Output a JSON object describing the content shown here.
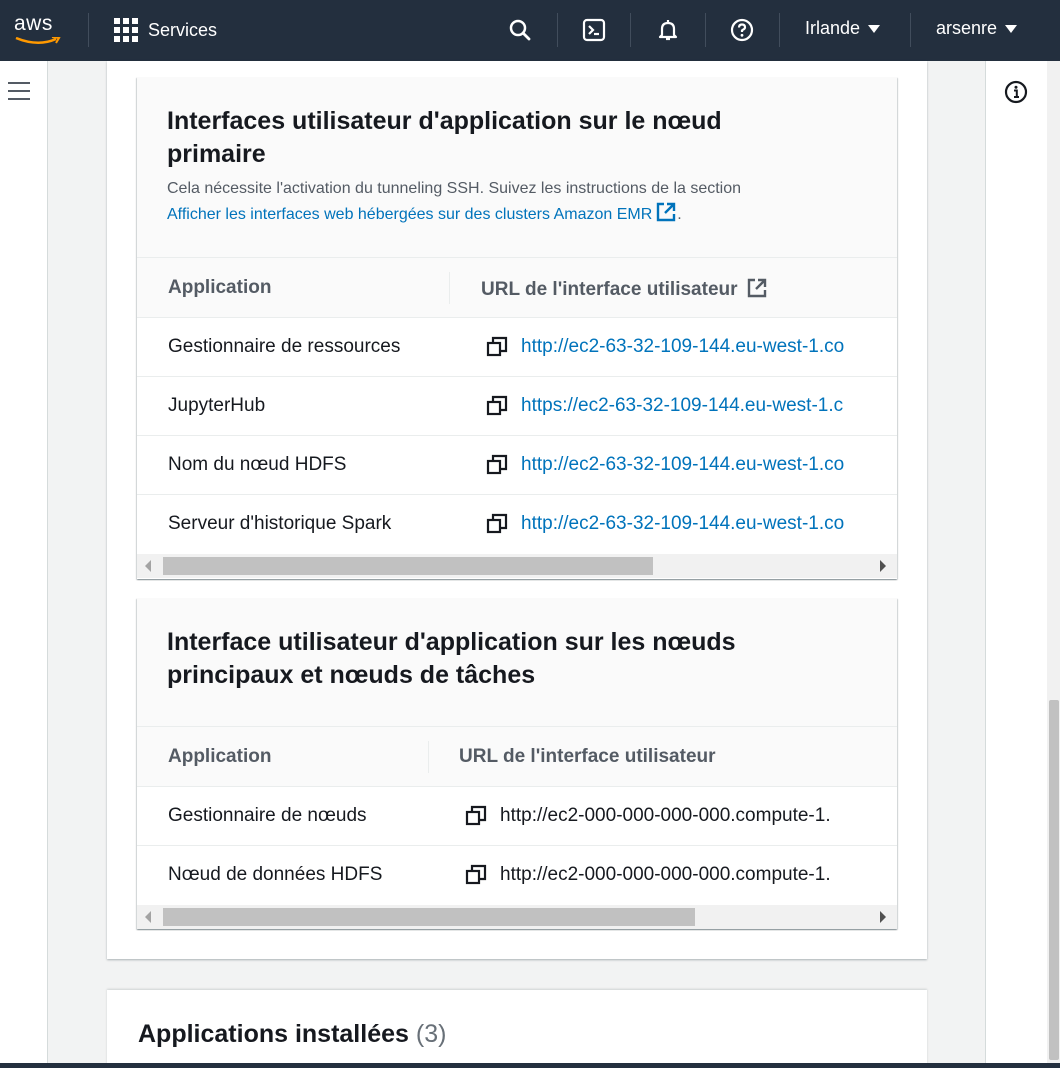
{
  "nav": {
    "logo": "aws",
    "services_label": "Services",
    "region_label": "Irlande",
    "user_label": "arsenre"
  },
  "primary_card": {
    "title": "Interfaces utilisateur d'application sur le nœud primaire",
    "desc_text": "Cela nécessite l'activation du tunneling SSH. Suivez les instructions de la section",
    "desc_link": "Afficher les interfaces web hébergées sur des clusters Amazon EMR",
    "desc_end": ".",
    "col_app": "Application",
    "col_url": "URL de l'interface utilisateur",
    "rows": [
      {
        "app": "Gestionnaire de ressources",
        "url": "http://ec2-63-32-109-144.eu-west-1.co"
      },
      {
        "app": "JupyterHub",
        "url": "https://ec2-63-32-109-144.eu-west-1.c"
      },
      {
        "app": "Nom du nœud HDFS",
        "url": "http://ec2-63-32-109-144.eu-west-1.co"
      },
      {
        "app": "Serveur d'historique Spark",
        "url": "http://ec2-63-32-109-144.eu-west-1.co"
      }
    ]
  },
  "core_card": {
    "title": "Interface utilisateur d'application sur les nœuds principaux et nœuds de tâches",
    "col_app": "Application",
    "col_url": "URL de l'interface utilisateur",
    "rows": [
      {
        "app": "Gestionnaire de nœuds",
        "url": "http://ec2-000-000-000-000.compute-1."
      },
      {
        "app": "Nœud de données HDFS",
        "url": "http://ec2-000-000-000-000.compute-1."
      }
    ]
  },
  "installed": {
    "title": "Applications installées",
    "count": "(3)"
  },
  "colors": {
    "nav_bg": "#232f3e",
    "link": "#0073bb"
  }
}
